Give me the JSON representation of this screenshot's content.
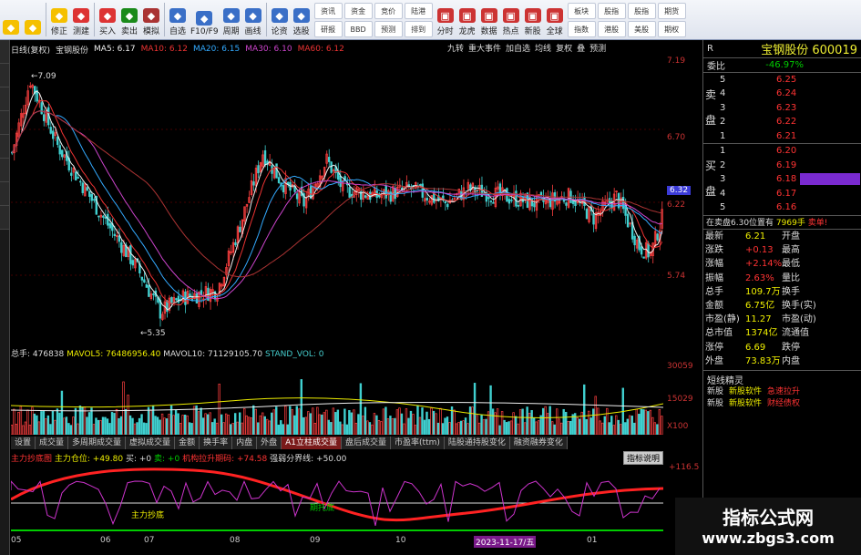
{
  "toolbar": {
    "left": [
      {
        "label": "",
        "icon": "back-icon"
      },
      {
        "label": "",
        "icon": "back-arrow-icon"
      },
      {
        "label": "修正",
        "icon": "fix-icon"
      },
      {
        "label": "测建",
        "icon": "test-icon"
      },
      {
        "label": "买入",
        "icon": "buy-icon"
      },
      {
        "label": "卖出",
        "icon": "sell-icon"
      },
      {
        "label": "模拟",
        "icon": "sim-icon"
      },
      {
        "label": "自选",
        "icon": "star-icon"
      },
      {
        "label": "F10/F9",
        "icon": "f10-icon"
      },
      {
        "label": "周期",
        "icon": "period-icon"
      },
      {
        "label": "画线",
        "icon": "draw-icon"
      },
      {
        "label": "论资",
        "icon": "info-icon"
      },
      {
        "label": "选股",
        "icon": "select-icon"
      }
    ],
    "grid1": [
      "资讯",
      "资金",
      "竞价",
      "陆港",
      "研报",
      "BBD",
      "预测",
      "排到"
    ],
    "right": [
      {
        "label": "分时",
        "icon": "time-icon"
      },
      {
        "label": "龙虎",
        "icon": "dragon-icon"
      },
      {
        "label": "数据",
        "icon": "data-icon"
      },
      {
        "label": "热点",
        "icon": "hot-icon"
      },
      {
        "label": "新股",
        "icon": "newstock-icon"
      },
      {
        "label": "全球",
        "icon": "globe-icon"
      }
    ],
    "grid2": [
      "板块",
      "股指",
      "股指",
      "期货",
      "指数",
      "港股",
      "美股",
      "期权"
    ]
  },
  "chart": {
    "period": "日线(复权)",
    "name": "宝钢股份",
    "ma": [
      {
        "k": "MA5: 6.17",
        "color": "#eeeeee"
      },
      {
        "k": "MA10: 6.12",
        "color": "#ee3333"
      },
      {
        "k": "MA20: 6.15",
        "color": "#33aaff"
      },
      {
        "k": "MA30: 6.10",
        "color": "#cc44cc"
      },
      {
        "k": "MA60: 6.12",
        "color": "#ee3333"
      }
    ],
    "tools": [
      "九转",
      "重大事件",
      "加自选",
      "均线",
      "复权",
      "叠",
      "预测"
    ],
    "yticks": [
      {
        "v": "7.19",
        "y": 0
      },
      {
        "v": "6.70",
        "y": 84
      },
      {
        "v": "6.32",
        "y": 142
      },
      {
        "v": "6.22",
        "y": 158
      },
      {
        "v": "5.74",
        "y": 236
      }
    ],
    "high_label": "7.09",
    "low_label": "5.35"
  },
  "volume": {
    "hdr": "总手: 476838",
    "mav5": "MAVOL5: 76486956.40",
    "mav10": "MAVOL10: 71129105.70",
    "std": "STAND_VOL: 0",
    "ticks": [
      "30059",
      "15029",
      "X100"
    ]
  },
  "tabs": [
    "设置",
    "成交量",
    "多周期成交量",
    "虚拟成交量",
    "金额",
    "换手率",
    "内盘",
    "外盘",
    "A1立柱成交量",
    "盘后成交量",
    "市盈率(ttm)",
    "陆股通持股变化",
    "融资融券变化"
  ],
  "indicator": {
    "name": "主力抄底图",
    "pos": "主力仓位: +49.80",
    "buy": "买: +0",
    "sell": "卖: +0",
    "org": "机构拉升期码: +74.58",
    "boundary": "强弱分界线: +50.00",
    "explain": "指标说明",
    "tick_top": "+116.5",
    "label1": "主力抄底",
    "label2": "期托底"
  },
  "dates": [
    {
      "t": "05",
      "x": 0
    },
    {
      "t": "06",
      "x": 98
    },
    {
      "t": "07",
      "x": 146
    },
    {
      "t": "08",
      "x": 240
    },
    {
      "t": "09",
      "x": 328
    },
    {
      "t": "10",
      "x": 422
    },
    {
      "t": "2023-11-17/五",
      "x": 508
    },
    {
      "t": "01",
      "x": 632
    }
  ],
  "right": {
    "title": "宝钢股份",
    "code": "600019",
    "tag": "R",
    "weibi": {
      "label": "委比",
      "value": "-46.97%"
    },
    "sell": [
      {
        "n": "5",
        "p": "6.25"
      },
      {
        "n": "4",
        "p": "6.24"
      },
      {
        "n": "3",
        "p": "6.23"
      },
      {
        "n": "2",
        "p": "6.22"
      },
      {
        "n": "1",
        "p": "6.21"
      }
    ],
    "buy": [
      {
        "n": "1",
        "p": "6.20"
      },
      {
        "n": "2",
        "p": "6.19"
      },
      {
        "n": "3",
        "p": "6.18"
      },
      {
        "n": "4",
        "p": "6.17"
      },
      {
        "n": "5",
        "p": "6.16"
      }
    ],
    "sell_side": "卖盘",
    "buy_side": "买盘",
    "info": "在卖盘6.30位置有",
    "info2": "7969手",
    "info3": "卖单!",
    "quote": [
      [
        "最新",
        "6.21",
        "开盘",
        ""
      ],
      [
        "涨跌",
        "+0.13",
        "最高",
        ""
      ],
      [
        "涨幅",
        "+2.14%",
        "最低",
        ""
      ],
      [
        "振幅",
        "2.63%",
        "量比",
        ""
      ],
      [
        "总手",
        "109.7万",
        "换手",
        ""
      ],
      [
        "金额",
        "6.75亿",
        "换手(实)",
        ""
      ],
      [
        "市盈(静)",
        "11.27",
        "市盈(动)",
        ""
      ],
      [
        "总市值",
        "1374亿",
        "流通值",
        ""
      ],
      [
        "涨停",
        "6.69",
        "跌停",
        ""
      ],
      [
        "外盘",
        "73.83万",
        "内盘",
        ""
      ]
    ],
    "sprite": "短线精灵",
    "items": [
      [
        "新股",
        "新股软件",
        "急速拉升"
      ],
      [
        "新股",
        "新股软件",
        "财经债权"
      ]
    ]
  },
  "watermark": {
    "line1": "指标公式网",
    "line2": "www.zbgs3.com"
  }
}
